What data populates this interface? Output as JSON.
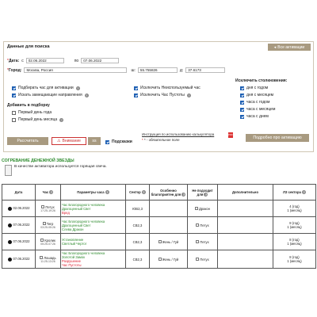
{
  "search": {
    "title": "Данные для поиска",
    "all_activations": "Все активации",
    "date_label": "Дата:",
    "date_from_prefix": "с",
    "date_from": "02.06.2022",
    "date_to_prefix": "по",
    "date_to": "07.06.2022",
    "city_label": "Город:",
    "city": "Москва, Россия",
    "lat_label": "ш:",
    "lat": "55.755826",
    "lon_label": "д:",
    "lon": "37.6173",
    "opts": [
      {
        "label": "Подбирать час для активации",
        "checked": true
      },
      {
        "label": "Искать замещающие направления",
        "checked": true
      }
    ],
    "opts2": [
      {
        "label": "Исключить Неиспользуемый час",
        "checked": true
      },
      {
        "label": "Исключить Час Пустоты",
        "checked": true
      }
    ],
    "add_title": "Добавить в подборку",
    "add_items": [
      {
        "label": "Первый день года",
        "checked": false
      },
      {
        "label": "Первый день месяца",
        "checked": false
      }
    ],
    "exclude_title": "Исключить столкновения:",
    "exclude_items": [
      {
        "label": "дня с годом",
        "checked": true
      },
      {
        "label": "дня с месяцем",
        "checked": true
      },
      {
        "label": "часа с годом",
        "checked": true
      },
      {
        "label": "часа с месяцем",
        "checked": true
      },
      {
        "label": "часа с днем",
        "checked": true
      }
    ],
    "calc_btn": "Рассчитать",
    "warn_btn": "Внимание",
    "warn_sel": "ss",
    "hints_label": "Подсказки",
    "instr_link": "Инструкция по использованию калькулятора",
    "required_note": "* - обязательное поле",
    "details_btn": "Подробно про активацию"
  },
  "section": {
    "title": "СОГРЕВАНИЕ ДЕНЕЖНОЙ ЗВЕЗДЫ",
    "note": "В качестве активатора используется горящая свеча."
  },
  "table": {
    "headers": [
      "Дата",
      "Час",
      "Параметры часа",
      "Сектор",
      "Особенно благоприятен для",
      "Не подходит для",
      "Дополнительно",
      "ЛЗ сектора"
    ],
    "rows": [
      {
        "date": "02.06.2022",
        "hour": "Петух",
        "time": "17:25-19:26",
        "params": [
          "Час Благородного человека",
          "Драгоценный Свет",
          "Вред"
        ],
        "sector": "ЮВ2,3",
        "good": "",
        "bad": "Дракон",
        "extra": "",
        "lz": [
          "4 (год)",
          "1 (месяц)"
        ]
      },
      {
        "date": "07.06.2022",
        "hour": "Тигр",
        "time": "03:25-05:26",
        "params": [
          "Час Благородного человека",
          "Драгоценный Свет",
          "Слева Дракон"
        ],
        "sector": "СВ2,3",
        "good": "",
        "bad": "Петух",
        "extra": "",
        "lz": [
          "8 (год)",
          "1 (месяц)"
        ]
      },
      {
        "date": "07.06.2022",
        "hour": "Кролик",
        "time": "05:25-07:26",
        "params": [
          "Установление",
          "Светлый Чертог"
        ],
        "sector": "СВ2,3",
        "good": "Жень / Гуй",
        "bad": "Петух",
        "extra": "",
        "lz": [
          "8 (год)",
          "1 (месяц)"
        ]
      },
      {
        "date": "07.06.2022",
        "hour": "Лошадь",
        "time": "11:25-13:26",
        "params": [
          "Час Благородного человека",
          "Золотой Замок",
          "Разрушение",
          "Час Пустоты"
        ],
        "sector": "СВ2,3",
        "good": "Жень / Гуй",
        "bad": "Петух",
        "extra": "",
        "lz": [
          "8 (год)",
          "1 (месяц)"
        ]
      }
    ]
  },
  "colors": {
    "accent": "#a89a80",
    "green": "#2c8a2c",
    "warning": "#cc3333"
  }
}
